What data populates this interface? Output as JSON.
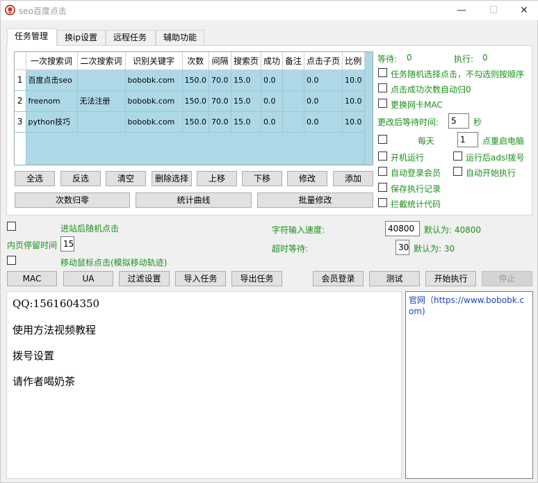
{
  "window": {
    "title": "seo百度点击",
    "minimize": "—",
    "maximize": "☐",
    "close": "✕"
  },
  "tabs": [
    {
      "label": "任务管理"
    },
    {
      "label": "换ip设置"
    },
    {
      "label": "远程任务"
    },
    {
      "label": "辅助功能"
    }
  ],
  "table": {
    "headers": [
      "一次搜索词",
      "二次搜索词",
      "识别关键字",
      "次数",
      "间隔",
      "搜索页",
      "成功",
      "备注",
      "点击子页",
      "比例"
    ],
    "rows": [
      {
        "n": "1",
        "cells": [
          "百度点击seo",
          "",
          "bobobk.com",
          "150.0",
          "70.0",
          "15.0",
          "0.0",
          "",
          "0.0",
          "10.0"
        ]
      },
      {
        "n": "2",
        "cells": [
          "freenom",
          "无法注册",
          "bobobk.com",
          "150.0",
          "70.0",
          "15.0",
          "0.0",
          "",
          "0.0",
          "10.0"
        ]
      },
      {
        "n": "3",
        "cells": [
          "python技巧",
          "",
          "bobobk.com",
          "150.0",
          "70.0",
          "15.0",
          "0.0",
          "",
          "0.0",
          "10.0"
        ]
      }
    ]
  },
  "table_buttons": [
    "全选",
    "反选",
    "清空",
    "删除选择",
    "上移",
    "下移",
    "修改",
    "添加"
  ],
  "wide_buttons": [
    "次数归零",
    "统计曲线",
    "批量修改"
  ],
  "right_panel": {
    "waiting_label": "等待:",
    "waiting_value": "0",
    "executing_label": "执行:",
    "executing_value": "0",
    "random_select": "任务随机选择点击，不勾选则按顺序",
    "auto_reset": "点击成功次数自动归0",
    "change_mac": "更换网卡MAC",
    "wait_after_label": "更改后等待时间:",
    "wait_after_value": "5",
    "wait_after_unit": "秒",
    "daily_label": "每天",
    "daily_value": "1",
    "daily_suffix": "点重启电脑",
    "startup_run": "开机运行",
    "adsl_dial": "运行后adsl拨号",
    "auto_login": "自动登录会员",
    "auto_start": "自动开始执行",
    "save_log": "保存执行记录",
    "block_stats": "拦截统计代码"
  },
  "middle": {
    "random_click": "进站后随机点击",
    "dwell_label": "内页停留时间",
    "dwell_value": "15",
    "mouse_move": "移动鼠标点击(模拟移动轨迹)",
    "speed_label": "字符输入速度:",
    "speed_value": "40800",
    "speed_default": "默认为: 40800",
    "timeout_label": "超时等待:",
    "timeout_value": "30",
    "timeout_default": "默认为: 30"
  },
  "bottom_buttons": {
    "mac": "MAC",
    "ua": "UA",
    "filter": "过滤设置",
    "import": "导入任务",
    "export": "导出任务",
    "member_login": "会员登录",
    "test": "测试",
    "start": "开始执行",
    "stop": "停止"
  },
  "info_left": [
    "QQ:1561604350",
    "使用方法视频教程",
    "拨号设置",
    "请作者喝奶茶"
  ],
  "info_right": "官网（https://www.bobobk.com)",
  "colors": {
    "grid_bg": "#add8e6",
    "green_text": "#1a8f1a",
    "link_blue": "#1f3fbf"
  }
}
